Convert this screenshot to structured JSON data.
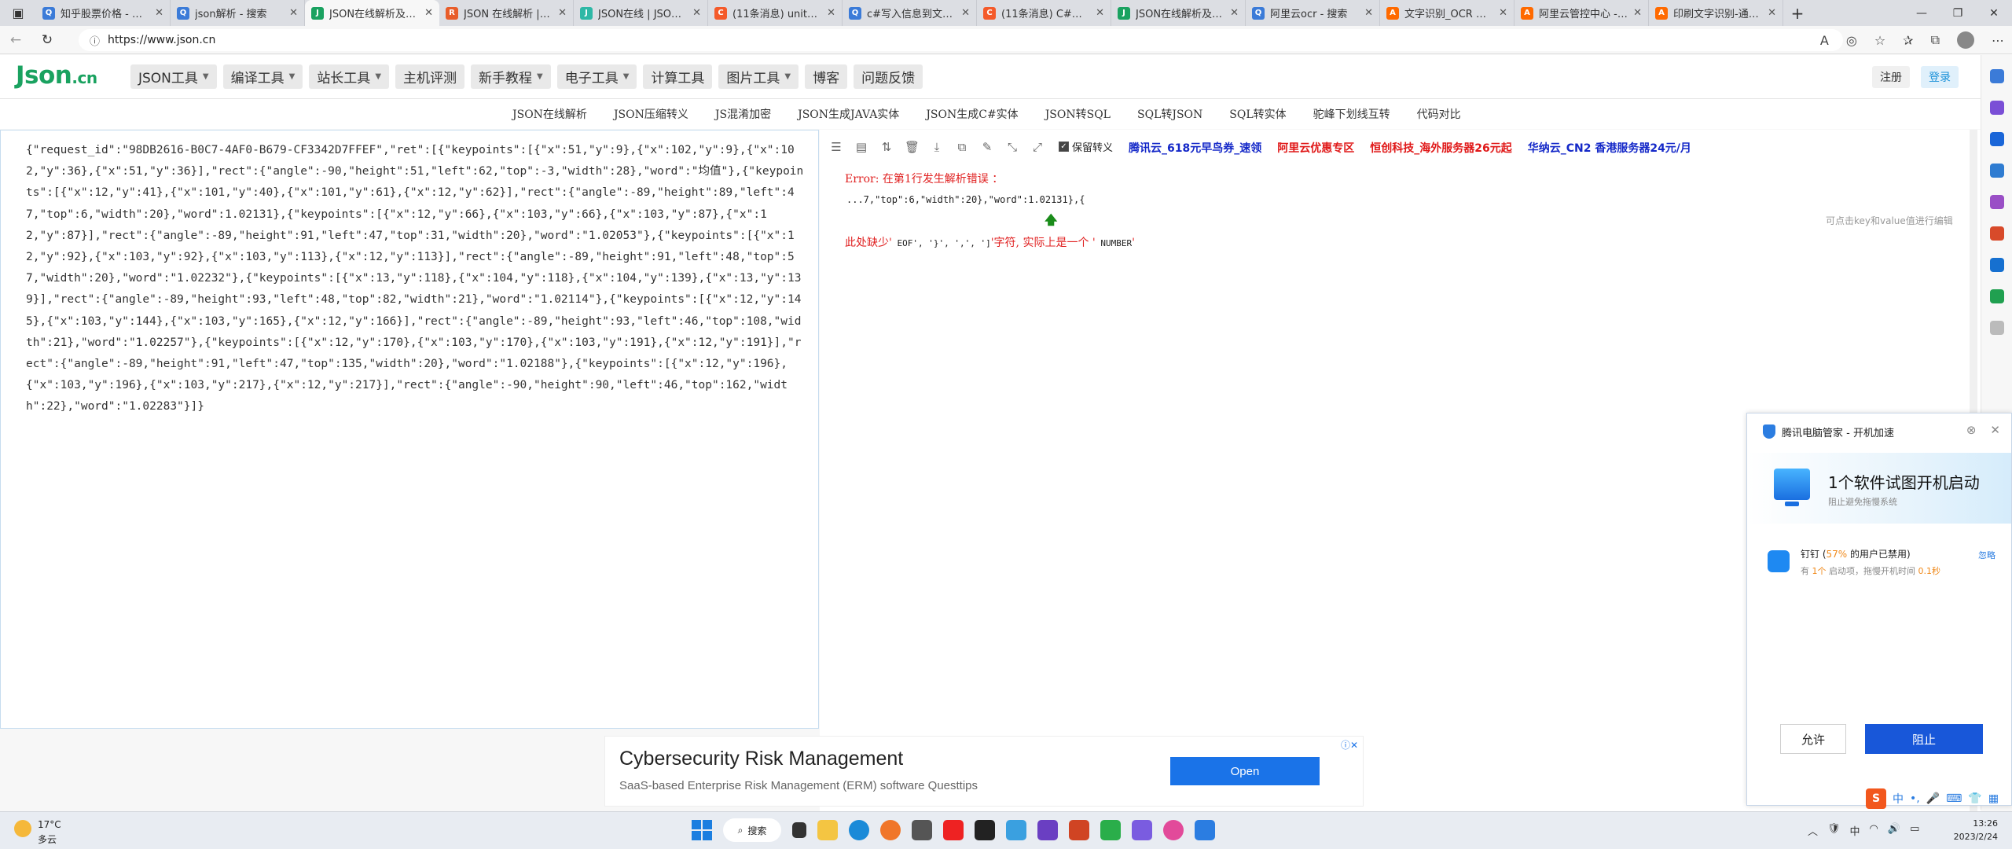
{
  "browser": {
    "tabs": [
      {
        "label": "知乎股票价格 - 搜索",
        "color": "#3b7bd8",
        "glyph": "Q"
      },
      {
        "label": "json解析 - 搜索",
        "color": "#3b7bd8",
        "glyph": "Q"
      },
      {
        "label": "JSON在线解析及格式",
        "color": "#1aa260",
        "glyph": "J",
        "active": true
      },
      {
        "label": "JSON 在线解析 | 菜鸟",
        "color": "#e85d2a",
        "glyph": "R"
      },
      {
        "label": "JSON在线 | JSON解析",
        "color": "#2eb8a6",
        "glyph": "J"
      },
      {
        "label": "(11条消息) unity json",
        "color": "#f45a2a",
        "glyph": "C"
      },
      {
        "label": "c#写入信息到文本 - 搜",
        "color": "#3b7bd8",
        "glyph": "Q"
      },
      {
        "label": "(11条消息) C#之txt的",
        "color": "#f45a2a",
        "glyph": "C"
      },
      {
        "label": "JSON在线解析及格式",
        "color": "#1aa260",
        "glyph": "J"
      },
      {
        "label": "阿里云ocr - 搜索",
        "color": "#3b7bd8",
        "glyph": "Q"
      },
      {
        "label": "文字识别_OCR 文字",
        "color": "#ff6a00",
        "glyph": "A"
      },
      {
        "label": "阿里云管控中心 - 工",
        "color": "#ff6a00",
        "glyph": "A"
      },
      {
        "label": "印刷文字识别-通用文",
        "color": "#ff6a00",
        "glyph": "A"
      }
    ],
    "url": "https://www.json.cn"
  },
  "site": {
    "logo_main": "Json",
    "logo_suffix": ".cn",
    "nav": [
      {
        "label": "JSON工具",
        "dropdown": true
      },
      {
        "label": "编译工具",
        "dropdown": true
      },
      {
        "label": "站长工具",
        "dropdown": true
      },
      {
        "label": "主机评测",
        "dropdown": false
      },
      {
        "label": "新手教程",
        "dropdown": true
      },
      {
        "label": "电子工具",
        "dropdown": true
      },
      {
        "label": "计算工具",
        "dropdown": false
      },
      {
        "label": "图片工具",
        "dropdown": true
      },
      {
        "label": "博客",
        "dropdown": false
      },
      {
        "label": "问题反馈",
        "dropdown": false
      }
    ],
    "register": "注册",
    "login": "登录",
    "subnav": [
      "JSON在线解析",
      "JSON压缩转义",
      "JS混淆加密",
      "JSON生成JAVA实体",
      "JSON生成C#实体",
      "JSON转SQL",
      "SQL转JSON",
      "SQL转实体",
      "驼峰下划线互转",
      "代码对比"
    ]
  },
  "editor": {
    "json_text": "{\"request_id\":\"98DB2616-B0C7-4AF0-B679-CF3342D7FFEF\",\"ret\":[{\"keypoints\":[{\"x\":51,\"y\":9},{\"x\":102,\"y\":9},{\"x\":102,\"y\":36},{\"x\":51,\"y\":36}],\"rect\":{\"angle\":-90,\"height\":51,\"left\":62,\"top\":-3,\"width\":28},\"word\":\"均值\"},{\"keypoints\":[{\"x\":12,\"y\":41},{\"x\":101,\"y\":40},{\"x\":101,\"y\":61},{\"x\":12,\"y\":62}],\"rect\":{\"angle\":-89,\"height\":89,\"left\":47,\"top\":6,\"width\":20},\"word\":1.02131},{\"keypoints\":[{\"x\":12,\"y\":66},{\"x\":103,\"y\":66},{\"x\":103,\"y\":87},{\"x\":12,\"y\":87}],\"rect\":{\"angle\":-89,\"height\":91,\"left\":47,\"top\":31,\"width\":20},\"word\":\"1.02053\"},{\"keypoints\":[{\"x\":12,\"y\":92},{\"x\":103,\"y\":92},{\"x\":103,\"y\":113},{\"x\":12,\"y\":113}],\"rect\":{\"angle\":-89,\"height\":91,\"left\":48,\"top\":57,\"width\":20},\"word\":\"1.02232\"},{\"keypoints\":[{\"x\":13,\"y\":118},{\"x\":104,\"y\":118},{\"x\":104,\"y\":139},{\"x\":13,\"y\":139}],\"rect\":{\"angle\":-89,\"height\":93,\"left\":48,\"top\":82,\"width\":21},\"word\":\"1.02114\"},{\"keypoints\":[{\"x\":12,\"y\":145},{\"x\":103,\"y\":144},{\"x\":103,\"y\":165},{\"x\":12,\"y\":166}],\"rect\":{\"angle\":-89,\"height\":93,\"left\":46,\"top\":108,\"width\":21},\"word\":\"1.02257\"},{\"keypoints\":[{\"x\":12,\"y\":170},{\"x\":103,\"y\":170},{\"x\":103,\"y\":191},{\"x\":12,\"y\":191}],\"rect\":{\"angle\":-89,\"height\":91,\"left\":47,\"top\":135,\"width\":20},\"word\":\"1.02188\"},{\"keypoints\":[{\"x\":12,\"y\":196},{\"x\":103,\"y\":196},{\"x\":103,\"y\":217},{\"x\":12,\"y\":217}],\"rect\":{\"angle\":-90,\"height\":90,\"left\":46,\"top\":162,\"width\":22},\"word\":\"1.02283\"}]}"
  },
  "toolbar": {
    "keep_escape": "保留转义"
  },
  "ads_top": [
    {
      "label": "腾讯云_618元早鸟券_速领",
      "color": "#1428c8"
    },
    {
      "label": "阿里云优惠专区",
      "color": "#e01818"
    },
    {
      "label": "恒创科技_海外服务器26元起",
      "color": "#e01818"
    },
    {
      "label": "华纳云_CN2 香港服务器24元/月",
      "color": "#1428c8"
    }
  ],
  "error": {
    "title": "Error: 在第1行发生解析错误 ：",
    "snippet": "...7,\"top\":6,\"width\":20},\"word\":1.02131},{",
    "arrow": "🡅",
    "msg_prefix": "此处缺少'",
    "msg_expected": " EOF', '}', ',', ']",
    "msg_mid": "'字符, 实际上是一个 '",
    "msg_actual": " NUMBER",
    "msg_suffix": "'"
  },
  "hint": "可点击key和value值进行编辑",
  "popup": {
    "title": "腾讯电脑管家 - 开机加速",
    "headline": "1个软件试图开机启动",
    "subline": "阻止避免拖慢系统",
    "app_name": "钉钉 (",
    "app_pct": "57%",
    "app_name_tail": " 的用户已禁用)",
    "app_sub_a": "有 ",
    "app_sub_n": "1个",
    "app_sub_b": " 启动项，拖慢开机时间 ",
    "app_sub_t": "0.1秒",
    "ignore": "忽略",
    "allow": "允许",
    "block": "阻止"
  },
  "bottom_ad": {
    "title": "Cybersecurity Risk Management",
    "subtitle": "SaaS-based Enterprise Risk Management (ERM) software Questtips",
    "cta": "Open"
  },
  "ime": {
    "logo": "S",
    "mode": "中"
  },
  "taskbar": {
    "temp": "17°C",
    "condition": "多云",
    "search": "搜索",
    "time": "13:26",
    "date": "2023/2/24"
  }
}
